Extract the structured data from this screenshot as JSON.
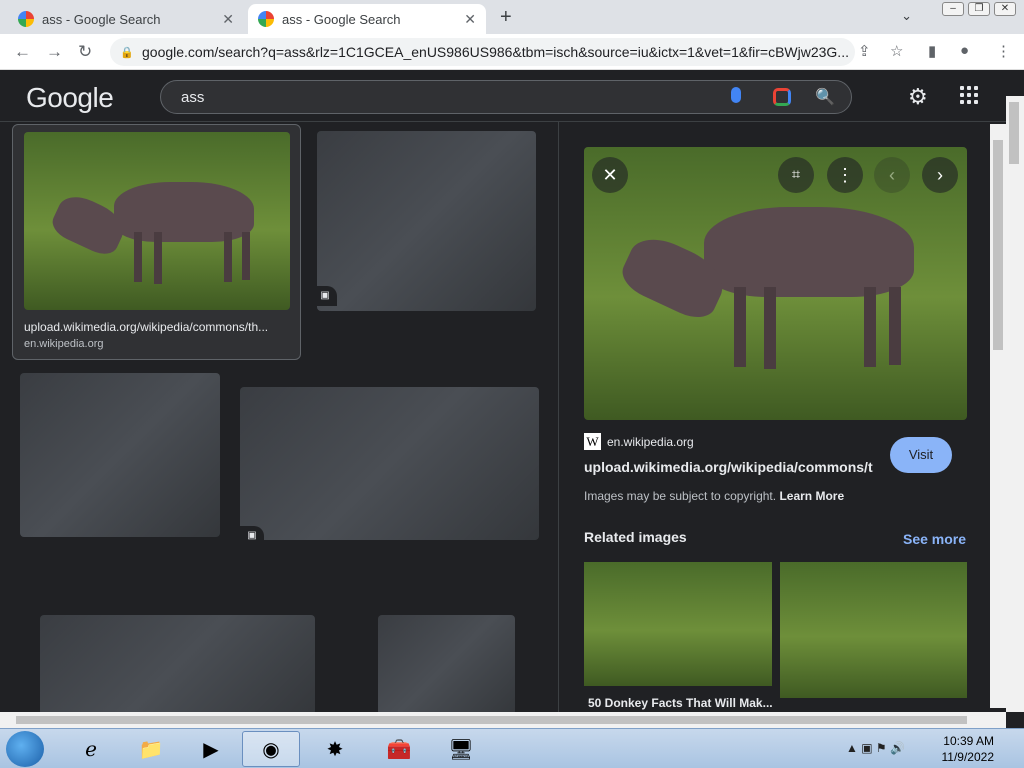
{
  "tabs": [
    {
      "title": "ass - Google Search"
    },
    {
      "title": "ass - Google Search"
    }
  ],
  "address": {
    "url": "google.com/search?q=ass&rlz=1C1GCEA_enUS986US986&tbm=isch&source=iu&ictx=1&vet=1&fir=cBWjw23G..."
  },
  "google": {
    "logo": "Google",
    "query": "ass"
  },
  "results": [
    {
      "caption": "upload.wikimedia.org/wikipedia/commons/th...",
      "source": "en.wikipedia.org"
    }
  ],
  "preview": {
    "site": "en.wikipedia.org",
    "title": "upload.wikimedia.org/wikipedia/commons/t",
    "visit_label": "Visit",
    "copyright": "Images may be subject to copyright.",
    "learn_more": "Learn More",
    "related_title": "Related images",
    "see_more": "See more",
    "related_caption": "50 Donkey Facts That Will Mak..."
  },
  "taskbar": {
    "time": "10:39 AM",
    "date": "11/9/2022"
  },
  "icons": {
    "close": "close-icon",
    "apps": "apps-grid-icon",
    "settings": "gear-icon"
  }
}
